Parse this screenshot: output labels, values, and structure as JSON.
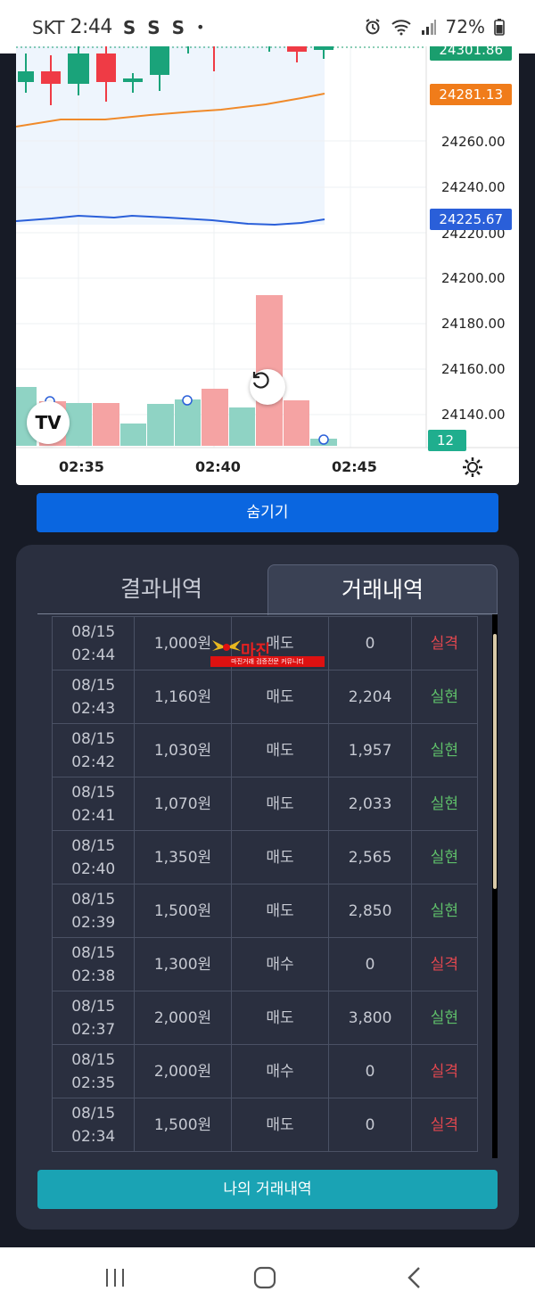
{
  "status_bar": {
    "carrier": "SKT",
    "time": "2:44",
    "notif": "S S S",
    "dot": "•",
    "battery": "72%"
  },
  "chart": {
    "price_tags": [
      {
        "value": "24301.86",
        "color": "#1a9e6e"
      },
      {
        "value": "24281.13",
        "color": "#f07c1a"
      },
      {
        "value": "24225.67",
        "color": "#2a5fd9"
      },
      {
        "value": "12",
        "color": "#1fae8e"
      }
    ],
    "y_axis": [
      "24260.00",
      "24240.00",
      "24220.00",
      "24200.00",
      "24180.00",
      "24160.00",
      "24140.00"
    ],
    "x_axis": [
      "02:35",
      "02:40",
      "02:45"
    ],
    "logo": "TV",
    "colors": {
      "up": "#1aa37a",
      "down": "#ef3b45",
      "vol_up": "#8fd3c4",
      "vol_down": "#f5a3a3"
    }
  },
  "hide_button": "숨기기",
  "tabs": {
    "result": "결과내역",
    "trade": "거래내역"
  },
  "watermark": {
    "title": "마진",
    "subtitle": "마진거래 검증전문 커뮤니티"
  },
  "trades": [
    {
      "date": "08/15",
      "time": "02:44",
      "amount": "1,000원",
      "type": "매도",
      "payout": "0",
      "result": "실격",
      "win": false
    },
    {
      "date": "08/15",
      "time": "02:43",
      "amount": "1,160원",
      "type": "매도",
      "payout": "2,204",
      "result": "실현",
      "win": true
    },
    {
      "date": "08/15",
      "time": "02:42",
      "amount": "1,030원",
      "type": "매도",
      "payout": "1,957",
      "result": "실현",
      "win": true
    },
    {
      "date": "08/15",
      "time": "02:41",
      "amount": "1,070원",
      "type": "매도",
      "payout": "2,033",
      "result": "실현",
      "win": true
    },
    {
      "date": "08/15",
      "time": "02:40",
      "amount": "1,350원",
      "type": "매도",
      "payout": "2,565",
      "result": "실현",
      "win": true
    },
    {
      "date": "08/15",
      "time": "02:39",
      "amount": "1,500원",
      "type": "매도",
      "payout": "2,850",
      "result": "실현",
      "win": true
    },
    {
      "date": "08/15",
      "time": "02:38",
      "amount": "1,300원",
      "type": "매수",
      "payout": "0",
      "result": "실격",
      "win": false
    },
    {
      "date": "08/15",
      "time": "02:37",
      "amount": "2,000원",
      "type": "매도",
      "payout": "3,800",
      "result": "실현",
      "win": true
    },
    {
      "date": "08/15",
      "time": "02:35",
      "amount": "2,000원",
      "type": "매수",
      "payout": "0",
      "result": "실격",
      "win": false
    },
    {
      "date": "08/15",
      "time": "02:34",
      "amount": "1,500원",
      "type": "매도",
      "payout": "0",
      "result": "실격",
      "win": false
    }
  ],
  "my_trades_button": "나의 거래내역"
}
